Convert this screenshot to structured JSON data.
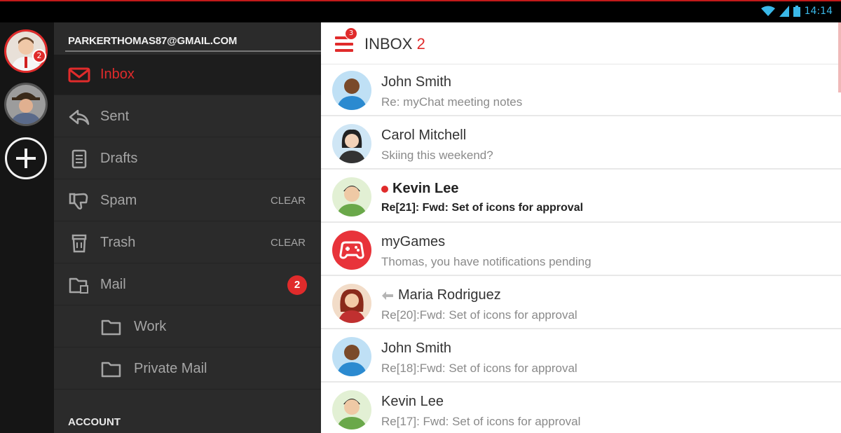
{
  "status_bar": {
    "time": "14:14",
    "icons": [
      "wifi-icon",
      "signal-icon",
      "battery-icon"
    ]
  },
  "colors": {
    "accent": "#e02b2b",
    "drawer_bg": "#2b2b2b",
    "rail_bg": "#151515",
    "status_time": "#3ab8e8"
  },
  "accounts": [
    {
      "name": "account-avatar-primary",
      "badge": "2"
    },
    {
      "name": "account-avatar-secondary"
    }
  ],
  "drawer": {
    "email": "PARKERTHOMAS87@GMAIL.COM",
    "items": [
      {
        "label": "Inbox",
        "icon": "envelope-icon",
        "selected": true
      },
      {
        "label": "Sent",
        "icon": "reply-icon"
      },
      {
        "label": "Drafts",
        "icon": "drafts-icon"
      },
      {
        "label": "Spam",
        "icon": "thumbs-down-icon",
        "action": "CLEAR"
      },
      {
        "label": "Trash",
        "icon": "trash-icon",
        "action": "CLEAR"
      },
      {
        "label": "Mail",
        "icon": "folder-icon",
        "count": "2"
      },
      {
        "label": "Work",
        "icon": "folder-icon",
        "sub": true
      },
      {
        "label": "Private Mail",
        "icon": "folder-icon",
        "sub": true
      }
    ],
    "section_header": "ACCOUNT"
  },
  "inbox": {
    "menu_badge": "3",
    "title": "INBOX",
    "count": "2",
    "messages": [
      {
        "sender": "John Smith",
        "preview": "Re: myChat meeting notes"
      },
      {
        "sender": "Carol Mitchell",
        "preview": "Skiing this weekend?"
      },
      {
        "sender": "Kevin Lee",
        "preview": "Re[21]: Fwd: Set of icons for approval",
        "unread": true
      },
      {
        "sender": "myGames",
        "preview": "Thomas, you have notifications pending",
        "icon": "gamepad-icon"
      },
      {
        "sender": "Maria Rodriguez",
        "preview": "Re[20]:Fwd:  Set of icons for approval",
        "replied": true
      },
      {
        "sender": "John Smith",
        "preview": "Re[18]:Fwd:  Set of icons for approval"
      },
      {
        "sender": "Kevin Lee",
        "preview": "Re[17]: Fwd: Set of icons for approval"
      }
    ]
  }
}
